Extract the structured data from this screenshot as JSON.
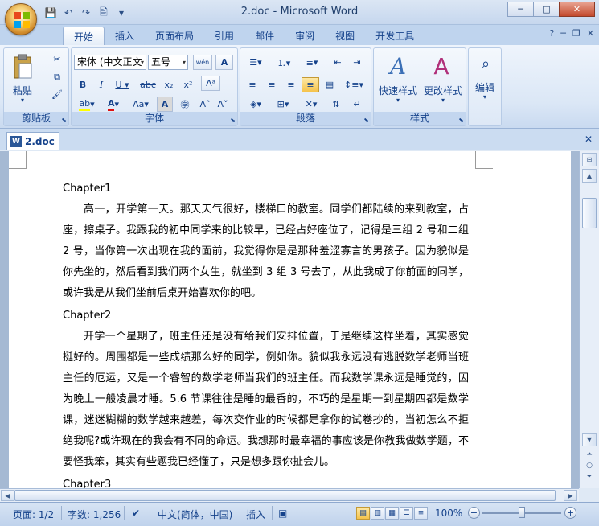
{
  "window": {
    "title": "2.doc - Microsoft Word",
    "controls": {
      "minimize": "─",
      "maximize": "□",
      "close": "✕"
    }
  },
  "quick_access": {
    "save": "💾",
    "undo": "↶",
    "redo": "↷",
    "print_preview": "🖹",
    "customize": "▾"
  },
  "ribbon_tabs": [
    "开始",
    "插入",
    "页面布局",
    "引用",
    "邮件",
    "审阅",
    "视图",
    "开发工具"
  ],
  "ribbon": {
    "clipboard": {
      "label": "剪贴板",
      "paste": "粘贴"
    },
    "font": {
      "label": "字体",
      "font_name": "宋体 (中文正文",
      "font_size": "五号",
      "wen": "wén"
    },
    "paragraph": {
      "label": "段落"
    },
    "styles": {
      "label": "样式",
      "quick_styles": "快速样式",
      "change_styles": "更改样式"
    },
    "editing": {
      "label": "编辑"
    }
  },
  "document_tab": {
    "name": "2.doc"
  },
  "document": {
    "sections": [
      {
        "heading": "Chapter1",
        "text": "高一，开学第一天。那天天气很好，楼梯口的教室。同学们都陆续的来到教室，占座，擦桌子。我跟我的初中同学来的比较早，已经占好座位了，记得是三组 2 号和二组 2 号，当你第一次出现在我的面前，我觉得你是是那种羞涩寡言的男孩子。因为貌似是你先坐的，然后看到我们两个女生，就坐到 3 组 3 号去了，从此我成了你前面的同学，或许我是从我们坐前后桌开始喜欢你的吧。"
      },
      {
        "heading": "Chapter2",
        "text": "开学一个星期了，班主任还是没有给我们安排位置，于是继续这样坐着，其实感觉挺好的。周围都是一些成绩那么好的同学，例如你。貌似我永远没有逃脱数学老师当班主任的厄运，又是一个睿智的数学老师当我们的班主任。而我数学课永远是睡觉的，因为晚上一般凌晨才睡。5.6 节课往往是睡的最香的，不巧的是星期一到星期四都是数学课，迷迷糊糊的数学越来越差，每次交作业的时候都是拿你的试卷抄的，当初怎么不拒绝我呢?或许现在的我会有不同的命运。我想那时最幸福的事应该是你教我做数学题，不要怪我笨，其实有些题我已经懂了，只是想多跟你扯会儿。"
      },
      {
        "heading": "Chapter3",
        "text": ""
      }
    ]
  },
  "status": {
    "page": "页面: 1/2",
    "words": "字数: 1,256",
    "language": "中文(简体，中国)",
    "mode": "插入",
    "zoom": "100%",
    "zoom_value": 100
  }
}
